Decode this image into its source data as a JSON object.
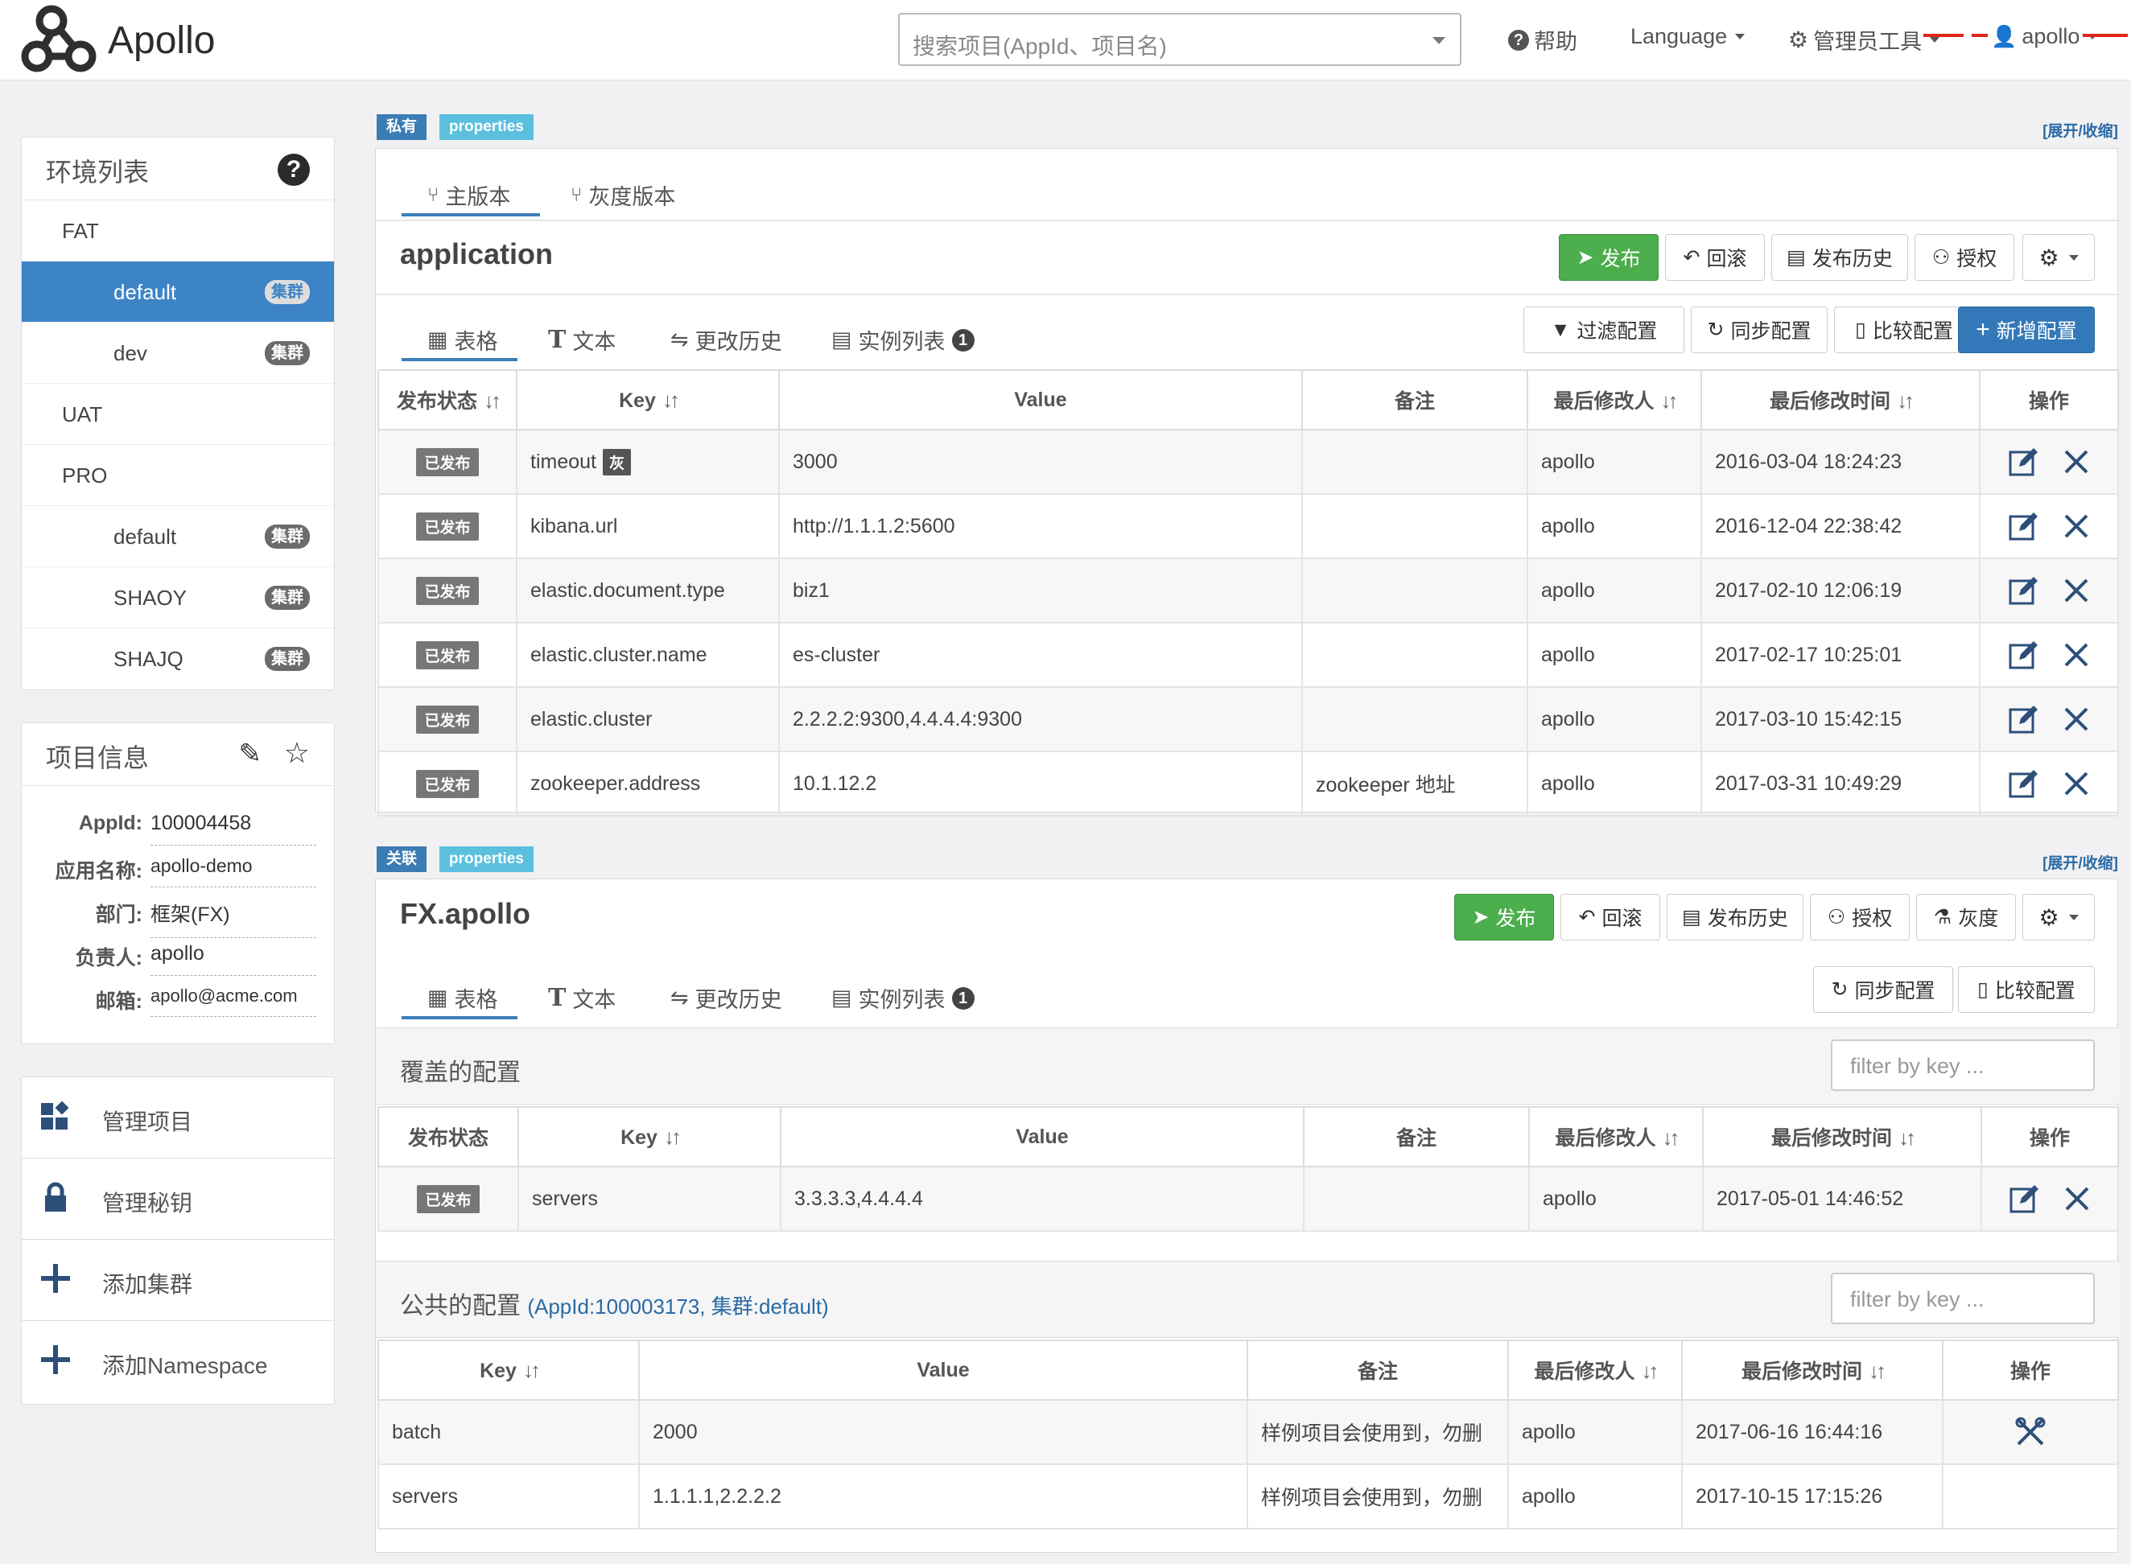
{
  "navbar": {
    "logo": "Apollo",
    "search_placeholder": "搜索项目(AppId、项目名)",
    "help": "帮助",
    "language": "Language",
    "admin_tools": "管理员工具",
    "user": "apollo"
  },
  "env_panel": {
    "title": "环境列表",
    "items": [
      {
        "label": "FAT",
        "type": "env"
      },
      {
        "label": "default",
        "type": "cluster",
        "badge": "集群",
        "active": true
      },
      {
        "label": "dev",
        "type": "cluster",
        "badge": "集群"
      },
      {
        "label": "UAT",
        "type": "env"
      },
      {
        "label": "PRO",
        "type": "env"
      },
      {
        "label": "default",
        "type": "cluster",
        "badge": "集群"
      },
      {
        "label": "SHAOY",
        "type": "cluster",
        "badge": "集群"
      },
      {
        "label": "SHAJQ",
        "type": "cluster",
        "badge": "集群"
      }
    ]
  },
  "project_info": {
    "title": "项目信息",
    "rows": [
      {
        "label": "AppId:",
        "value": "100004458"
      },
      {
        "label": "应用名称:",
        "value": "apollo-demo"
      },
      {
        "label": "部门:",
        "value": "框架(FX)"
      },
      {
        "label": "负责人:",
        "value": "apollo"
      },
      {
        "label": "邮箱:",
        "value": "apollo@acme.com"
      }
    ]
  },
  "actions": [
    {
      "label": "管理项目",
      "icon": "grid-icon"
    },
    {
      "label": "管理秘钥",
      "icon": "lock-icon"
    },
    {
      "label": "添加集群",
      "icon": "plus-icon"
    },
    {
      "label": "添加Namespace",
      "icon": "plus-icon"
    }
  ],
  "ns1": {
    "tag_scope": "私有",
    "tag_format": "properties",
    "expand": "[展开/收缩]",
    "tabs": [
      "主版本",
      "灰度版本"
    ],
    "title": "application",
    "buttons": {
      "publish": "发布",
      "rollback": "回滚",
      "history": "发布历史",
      "auth": "授权"
    },
    "subtabs": [
      "表格",
      "文本",
      "更改历史",
      "实例列表"
    ],
    "instance_count": "1",
    "tools": {
      "filter": "过滤配置",
      "sync": "同步配置",
      "compare": "比较配置",
      "add": "新增配置"
    },
    "headers": [
      "发布状态",
      "Key",
      "Value",
      "备注",
      "最后修改人",
      "最后修改时间",
      "操作"
    ],
    "gray_badge": "灰",
    "rows": [
      {
        "status": "已发布",
        "key": "timeout",
        "gray": true,
        "value": "3000",
        "comment": "",
        "user": "apollo",
        "time": "2016-03-04 18:24:23"
      },
      {
        "status": "已发布",
        "key": "kibana.url",
        "value": "http://1.1.1.2:5600",
        "comment": "",
        "user": "apollo",
        "time": "2016-12-04 22:38:42"
      },
      {
        "status": "已发布",
        "key": "elastic.document.type",
        "value": "biz1",
        "comment": "",
        "user": "apollo",
        "time": "2017-02-10 12:06:19"
      },
      {
        "status": "已发布",
        "key": "elastic.cluster.name",
        "value": "es-cluster",
        "comment": "",
        "user": "apollo",
        "time": "2017-02-17 10:25:01"
      },
      {
        "status": "已发布",
        "key": "elastic.cluster",
        "value": "2.2.2.2:9300,4.4.4.4:9300",
        "comment": "",
        "user": "apollo",
        "time": "2017-03-10 15:42:15"
      },
      {
        "status": "已发布",
        "key": "zookeeper.address",
        "value": "10.1.12.2",
        "comment": "zookeeper 地址",
        "user": "apollo",
        "time": "2017-03-31 10:49:29"
      }
    ]
  },
  "ns2": {
    "tag_scope": "关联",
    "tag_format": "properties",
    "expand": "[展开/收缩]",
    "title": "FX.apollo",
    "buttons": {
      "publish": "发布",
      "rollback": "回滚",
      "history": "发布历史",
      "auth": "授权",
      "gray": "灰度"
    },
    "subtabs": [
      "表格",
      "文本",
      "更改历史",
      "实例列表"
    ],
    "instance_count": "1",
    "tools": {
      "sync": "同步配置",
      "compare": "比较配置"
    },
    "override": {
      "title": "覆盖的配置",
      "filter_placeholder": "filter by key ...",
      "headers": [
        "发布状态",
        "Key",
        "Value",
        "备注",
        "最后修改人",
        "最后修改时间",
        "操作"
      ],
      "rows": [
        {
          "status": "已发布",
          "key": "servers",
          "value": "3.3.3.3,4.4.4.4",
          "comment": "",
          "user": "apollo",
          "time": "2017-05-01 14:46:52"
        }
      ]
    },
    "public": {
      "title": "公共的配置",
      "subtitle": "(AppId:100003173, 集群:default)",
      "filter_placeholder": "filter by key ...",
      "headers": [
        "Key",
        "Value",
        "备注",
        "最后修改人",
        "最后修改时间",
        "操作"
      ],
      "rows": [
        {
          "key": "batch",
          "value": "2000",
          "comment": "样例项目会使用到，勿删",
          "user": "apollo",
          "time": "2017-06-16 16:44:16"
        },
        {
          "key": "servers",
          "value": "1.1.1.1,2.2.2.2",
          "comment": "样例项目会使用到，勿删",
          "user": "apollo",
          "time": "2017-10-15 17:15:26"
        }
      ]
    }
  }
}
